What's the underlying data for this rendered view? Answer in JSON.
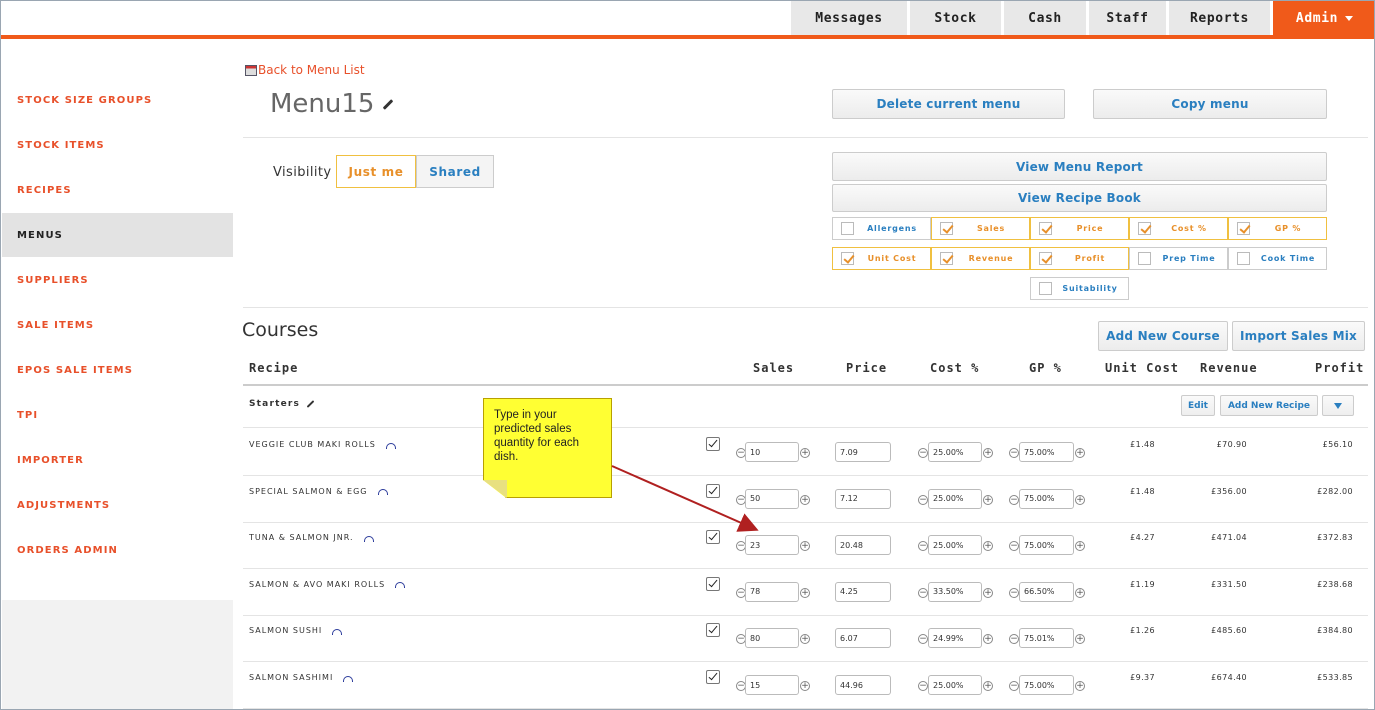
{
  "nav": {
    "tabs": [
      {
        "label": "Messages"
      },
      {
        "label": "Stock"
      },
      {
        "label": "Cash"
      },
      {
        "label": "Staff"
      },
      {
        "label": "Reports"
      },
      {
        "label": "Admin"
      }
    ]
  },
  "sidebar": {
    "items": [
      {
        "label": "STOCK SIZE GROUPS",
        "active": false
      },
      {
        "label": "STOCK ITEMS",
        "active": false
      },
      {
        "label": "RECIPES",
        "active": false
      },
      {
        "label": "MENUS",
        "active": true
      },
      {
        "label": "SUPPLIERS",
        "active": false
      },
      {
        "label": "SALE ITEMS",
        "active": false
      },
      {
        "label": "EPOS SALE ITEMS",
        "active": false
      },
      {
        "label": "TPI",
        "active": false
      },
      {
        "label": "IMPORTER",
        "active": false
      },
      {
        "label": "ADJUSTMENTS",
        "active": false
      },
      {
        "label": "ORDERS ADMIN",
        "active": false
      }
    ]
  },
  "header": {
    "back_label": "Back to Menu List",
    "menu_name": "Menu15",
    "delete_label": "Delete current menu",
    "copy_label": "Copy menu"
  },
  "visibility": {
    "label": "Visibility",
    "options": [
      "Just me",
      "Shared"
    ],
    "selected": "Just me"
  },
  "reports": {
    "menu_report_label": "View Menu Report",
    "recipe_book_label": "View Recipe Book"
  },
  "columns_toggle": {
    "row1": [
      {
        "label": "Allergens",
        "checked": false
      },
      {
        "label": "Sales",
        "checked": true
      },
      {
        "label": "Price",
        "checked": true
      },
      {
        "label": "Cost %",
        "checked": true
      },
      {
        "label": "GP %",
        "checked": true
      }
    ],
    "row2": [
      {
        "label": "Unit Cost",
        "checked": true
      },
      {
        "label": "Revenue",
        "checked": true
      },
      {
        "label": "Profit",
        "checked": true
      },
      {
        "label": "Prep Time",
        "checked": false
      },
      {
        "label": "Cook Time",
        "checked": false
      }
    ],
    "suitability": {
      "label": "Suitability",
      "checked": false
    }
  },
  "courses": {
    "title": "Courses",
    "add_course_label": "Add New Course",
    "import_label": "Import Sales Mix",
    "headers": {
      "recipe": "Recipe",
      "sales": "Sales",
      "price": "Price",
      "cost": "Cost %",
      "gp": "GP %",
      "unit_cost": "Unit Cost",
      "revenue": "Revenue",
      "profit": "Profit"
    },
    "section": {
      "name": "Starters",
      "edit_label": "Edit",
      "add_recipe_label": "Add New Recipe"
    },
    "rows": [
      {
        "name": "VEGGIE CLUB MAKI ROLLS",
        "sales": "10",
        "price": "7.09",
        "cost": "25.00%",
        "gp": "75.00%",
        "unit_cost": "£1.48",
        "revenue": "£70.90",
        "profit": "£56.10"
      },
      {
        "name": "SPECIAL SALMON & EGG",
        "sales": "50",
        "price": "7.12",
        "cost": "25.00%",
        "gp": "75.00%",
        "unit_cost": "£1.48",
        "revenue": "£356.00",
        "profit": "£282.00"
      },
      {
        "name": "TUNA & SALMON JNR.",
        "sales": "23",
        "price": "20.48",
        "cost": "25.00%",
        "gp": "75.00%",
        "unit_cost": "£4.27",
        "revenue": "£471.04",
        "profit": "£372.83"
      },
      {
        "name": "SALMON & AVO MAKI ROLLS",
        "sales": "78",
        "price": "4.25",
        "cost": "33.50%",
        "gp": "66.50%",
        "unit_cost": "£1.19",
        "revenue": "£331.50",
        "profit": "£238.68"
      },
      {
        "name": "SALMON SUSHI",
        "sales": "80",
        "price": "6.07",
        "cost": "24.99%",
        "gp": "75.01%",
        "unit_cost": "£1.26",
        "revenue": "£485.60",
        "profit": "£384.80"
      },
      {
        "name": "SALMON SASHIMI",
        "sales": "15",
        "price": "44.96",
        "cost": "25.00%",
        "gp": "75.00%",
        "unit_cost": "£9.37",
        "revenue": "£674.40",
        "profit": "£533.85"
      }
    ]
  },
  "callout": {
    "text": "Type in your predicted sales quantity for each dish."
  },
  "colors": {
    "accent": "#f05a1a",
    "link": "#2a7fc0",
    "toggle_on": "#e8902a",
    "callout": "#ffff33",
    "arrow": "#b02020"
  }
}
